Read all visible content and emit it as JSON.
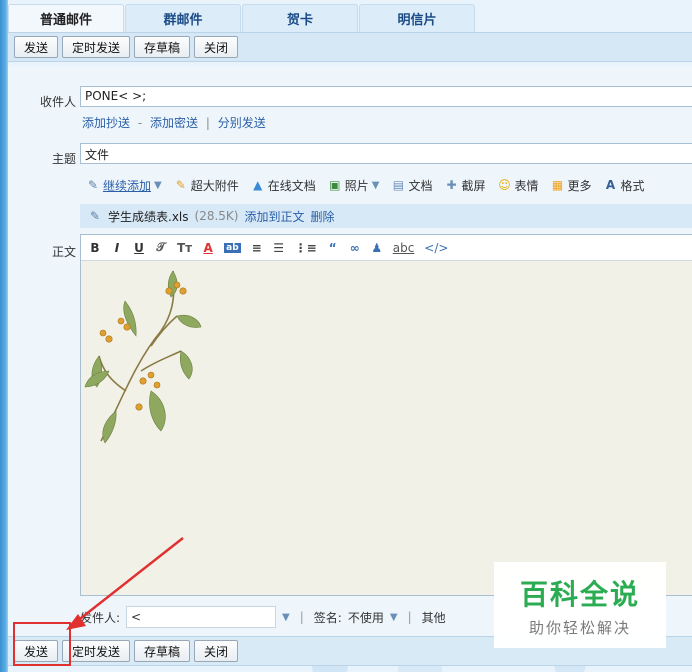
{
  "tabs": [
    "普通邮件",
    "群邮件",
    "贺卡",
    "明信片"
  ],
  "toolbar": {
    "send": "发送",
    "scheduled_send": "定时发送",
    "save_draft": "存草稿",
    "close": "关闭"
  },
  "form": {
    "to_label": "收件人",
    "to_value": "PONE<                             >;",
    "add_cc": "添加抄送",
    "sep_dash": "-",
    "add_bcc": "添加密送",
    "sep_bar": "|",
    "separate_send": "分别发送",
    "subject_label": "主题",
    "subject_value": "文件",
    "body_label": "正文"
  },
  "attach_toolbar": {
    "continue_add": "继续添加",
    "large_attach": "超大附件",
    "online_doc": "在线文档",
    "photo": "照片",
    "document": "文档",
    "screenshot": "截屏",
    "emoji": "表情",
    "more": "更多",
    "format": "格式"
  },
  "attachment": {
    "name": "学生成绩表.xls",
    "size": "(28.5K)",
    "add_to_body": "添加到正文",
    "delete": "删除"
  },
  "editor_toolbar": [
    "B",
    "I",
    "U",
    "𝒯",
    "Tт",
    "A",
    "ab",
    "≡",
    "☰",
    "⋮≡",
    "“",
    "∞",
    "♟",
    "abc",
    "</>"
  ],
  "footer": {
    "sender_label": "发件人:",
    "sender_value": "<",
    "signature_label": "签名:",
    "signature_value": "不使用",
    "other_label": "其他"
  },
  "watermark": {
    "title": "百科全说",
    "subtitle": "助你轻松解决"
  },
  "colors": {
    "link": "#2a5fa8",
    "highlight": "#e03030",
    "watermark_green": "#2bac53"
  }
}
